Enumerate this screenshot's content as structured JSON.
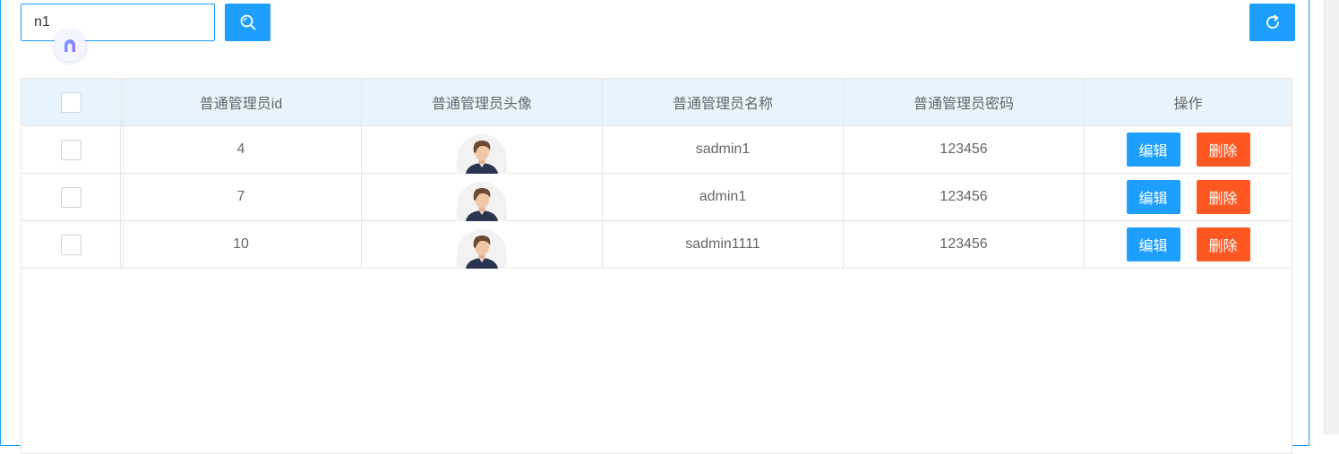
{
  "search": {
    "value": "n1"
  },
  "table": {
    "columns": [
      "普通管理员id",
      "普通管理员头像",
      "普通管理员名称",
      "普通管理员密码",
      "操作"
    ],
    "rows": [
      {
        "id": "4",
        "name": "sadmin1",
        "password": "123456"
      },
      {
        "id": "7",
        "name": "admin1",
        "password": "123456"
      },
      {
        "id": "10",
        "name": "sadmin1111",
        "password": "123456"
      }
    ],
    "edit_label": "编辑",
    "delete_label": "删除"
  },
  "icons": {
    "search": "search-icon",
    "refresh": "refresh-icon",
    "badge": "assistant-badge-icon",
    "avatar": "user-avatar-icon"
  },
  "colors": {
    "primary": "#1E9FFF",
    "danger": "#FF5722",
    "header_bg": "#e8f4fd"
  }
}
